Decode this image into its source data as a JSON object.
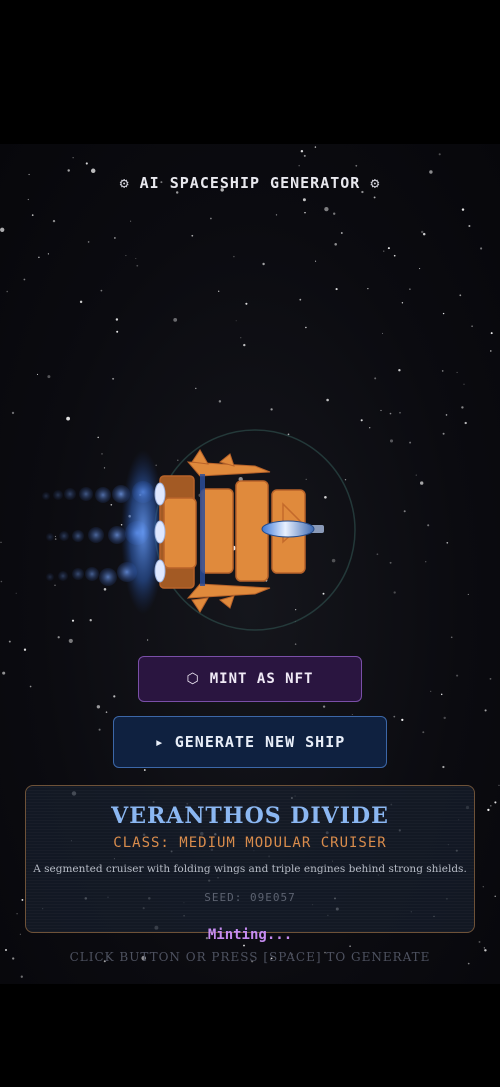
{
  "header": {
    "title": "AI SPACESHIP GENERATOR",
    "icon_left": "gear-icon",
    "icon_right": "gear-icon"
  },
  "buttons": {
    "mint_label": "MINT AS NFT",
    "mint_icon": "hexagon-icon",
    "generate_label": "GENERATE NEW SHIP",
    "generate_icon": "play-icon"
  },
  "ship": {
    "name": "VERANTHOS DIVIDE",
    "class": "CLASS: MEDIUM MODULAR CRUISER",
    "description": "A segmented cruiser with folding wings and triple engines behind strong shields.",
    "seed": "SEED: 09E057"
  },
  "status": {
    "text": "Minting..."
  },
  "hint": {
    "text": "CLICK BUTTON OR PRESS [SPACE] TO GENERATE"
  },
  "colors": {
    "hull": "#e08a3c",
    "hull_dark": "#a35a24",
    "shield": "#4a7fd8",
    "engine_glow": "#cfe0ff",
    "mint_accent": "#7a4fa8",
    "generate_accent": "#3c67a8",
    "name_color": "#8bb7f2",
    "class_color": "#d98c4c",
    "status_color": "#c58bf0"
  }
}
